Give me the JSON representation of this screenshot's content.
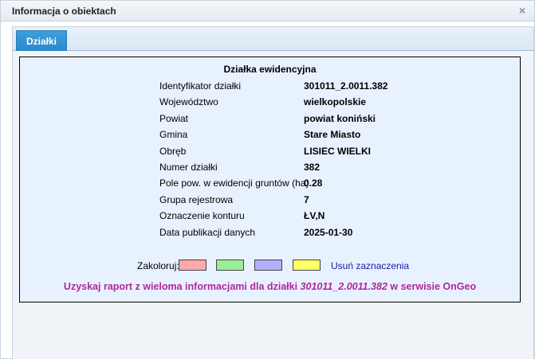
{
  "window": {
    "title": "Informacja o obiektach",
    "close_icon": "×"
  },
  "tabs": [
    {
      "label": "Działki",
      "active": true
    }
  ],
  "panel": {
    "heading": "Działka ewidencyjna",
    "rows": [
      {
        "label": "Identyfikator działki",
        "value": "301011_2.0011.382"
      },
      {
        "label": "Województwo",
        "value": "wielkopolskie"
      },
      {
        "label": "Powiat",
        "value": "powiat koniński"
      },
      {
        "label": "Gmina",
        "value": "Stare Miasto"
      },
      {
        "label": "Obręb",
        "value": "LISIEC WIELKI"
      },
      {
        "label": "Numer działki",
        "value": "382"
      },
      {
        "label": "Pole pow. w ewidencji gruntów (ha)",
        "value": "0.28"
      },
      {
        "label": "Grupa rejestrowa",
        "value": "7"
      },
      {
        "label": "Oznaczenie konturu",
        "value": "ŁV,N"
      },
      {
        "label": "Data publikacji danych",
        "value": "2025-01-30"
      }
    ],
    "colorize": {
      "label": "Zakoloruj:",
      "swatches": [
        "#ffaaaa",
        "#99ee99",
        "#b0b0ff",
        "#ffff66"
      ],
      "clear_label": "Usuń zaznaczenia"
    },
    "report": {
      "prefix": "Uzyskaj raport z wieloma informacjami dla działki ",
      "parcel_id": "301011_2.0011.382",
      "suffix": " w serwisie OnGeo"
    }
  },
  "colors": {
    "accent": "#2b88c9",
    "panel_bg": "#e8f2ff",
    "report_text": "#b0279a",
    "link": "#1a1aa6"
  }
}
